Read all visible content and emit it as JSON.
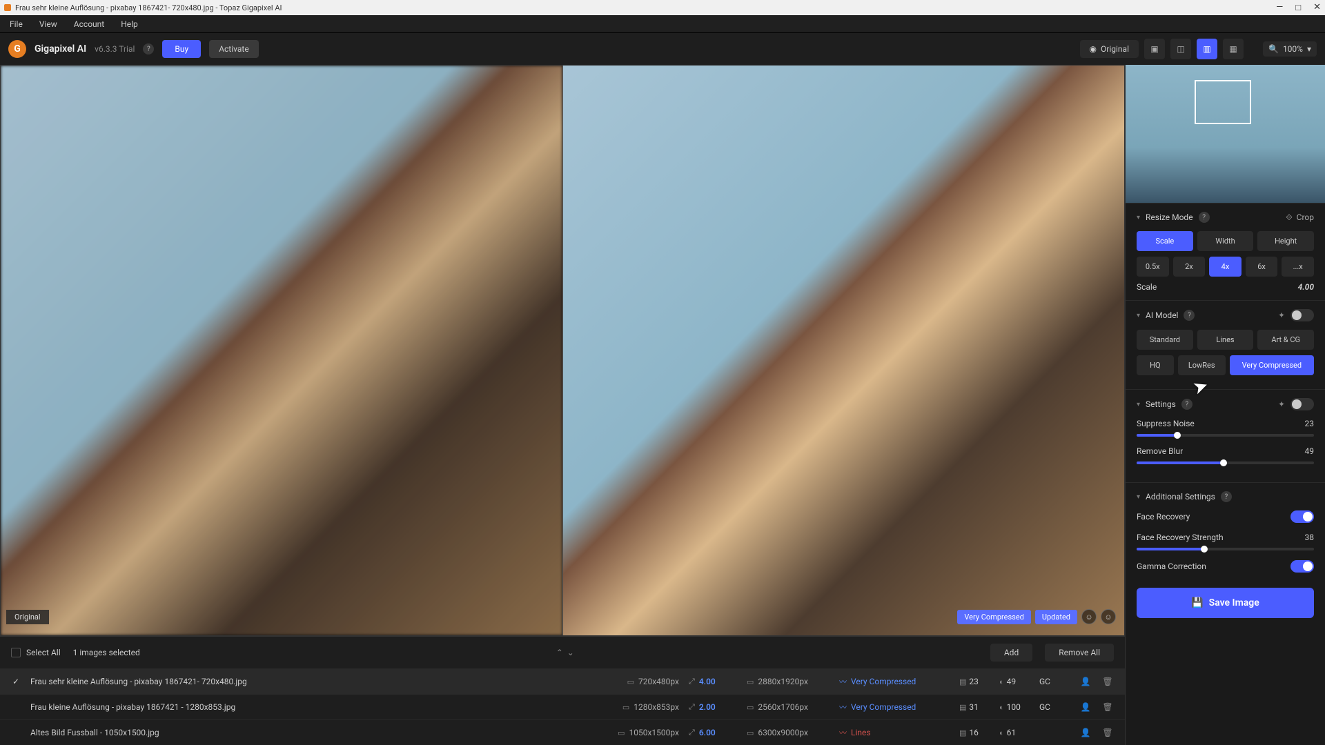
{
  "window": {
    "title": "Frau sehr kleine Auflösung - pixabay 1867421- 720x480.jpg - Topaz Gigapixel AI"
  },
  "menu": {
    "file": "File",
    "view": "View",
    "account": "Account",
    "help": "Help"
  },
  "app": {
    "name": "Gigapixel AI",
    "version": "v6.3.3 Trial",
    "buy": "Buy",
    "activate": "Activate"
  },
  "toolbar": {
    "original": "Original",
    "zoom": "100%"
  },
  "viewport": {
    "original_label": "Original",
    "model_badge": "Very Compressed",
    "updated_badge": "Updated"
  },
  "queue_head": {
    "select_all": "Select All",
    "selected": "1 images selected",
    "add": "Add",
    "remove_all": "Remove All"
  },
  "files": [
    {
      "name": "Frau sehr kleine Auflösung - pixabay 1867421- 720x480.jpg",
      "src_dim": "720x480px",
      "scale": "4.00",
      "out_dim": "2880x1920px",
      "model": "Very Compressed",
      "noise": "23",
      "blur": "49",
      "gc": "GC",
      "selected": true
    },
    {
      "name": "Frau kleine Auflösung - pixabay 1867421 - 1280x853.jpg",
      "src_dim": "1280x853px",
      "scale": "2.00",
      "out_dim": "2560x1706px",
      "model": "Very Compressed",
      "noise": "31",
      "blur": "100",
      "gc": "GC",
      "selected": false
    },
    {
      "name": "Altes Bild Fussball - 1050x1500.jpg",
      "src_dim": "1050x1500px",
      "scale": "6.00",
      "out_dim": "6300x9000px",
      "model": "Lines",
      "noise": "16",
      "blur": "61",
      "gc": "",
      "selected": false
    }
  ],
  "panel": {
    "resize_mode": "Resize Mode",
    "crop": "Crop",
    "mode_tabs": {
      "scale": "Scale",
      "width": "Width",
      "height": "Height"
    },
    "scale_presets": [
      "0.5x",
      "2x",
      "4x",
      "6x",
      "...x"
    ],
    "scale_label": "Scale",
    "scale_value": "4.00",
    "ai_model": "AI Model",
    "model_row1": [
      "Standard",
      "Lines",
      "Art & CG"
    ],
    "model_row2": [
      "HQ",
      "LowRes",
      "Very Compressed"
    ],
    "settings": "Settings",
    "suppress_noise": "Suppress Noise",
    "suppress_noise_val": "23",
    "remove_blur": "Remove Blur",
    "remove_blur_val": "49",
    "additional": "Additional Settings",
    "face_recovery": "Face Recovery",
    "face_strength": "Face Recovery Strength",
    "face_strength_val": "38",
    "gamma": "Gamma Correction",
    "save": "Save Image"
  }
}
